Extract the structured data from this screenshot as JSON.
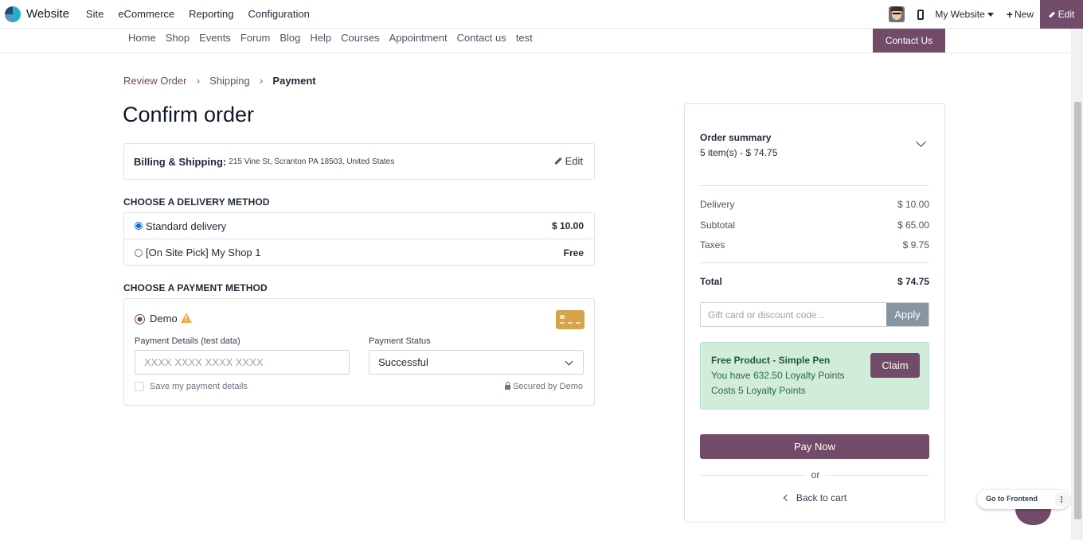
{
  "topbar": {
    "app_name": "Website",
    "menu": [
      "Site",
      "eCommerce",
      "Reporting",
      "Configuration"
    ],
    "site_switcher": "My Website",
    "new_label": "New",
    "edit_label": "Edit"
  },
  "sitenav": {
    "links": [
      "Home",
      "Shop",
      "Events",
      "Forum",
      "Blog",
      "Help",
      "Courses",
      "Appointment",
      "Contact us",
      "test"
    ],
    "contact_button": "Contact Us"
  },
  "breadcrumb": {
    "items": [
      "Review Order",
      "Shipping"
    ],
    "current": "Payment"
  },
  "page_title": "Confirm order",
  "billing": {
    "label": "Billing & Shipping:",
    "address": "215 Vine St, Scranton PA 18503, United States",
    "edit_label": "Edit"
  },
  "delivery": {
    "title": "CHOOSE A DELIVERY METHOD",
    "methods": [
      {
        "name": "Standard delivery",
        "price": "$ 10.00",
        "selected": true
      },
      {
        "name": "[On Site Pick] My Shop 1",
        "price": "Free",
        "selected": false
      }
    ]
  },
  "payment": {
    "title": "CHOOSE A PAYMENT METHOD",
    "provider": "Demo",
    "details_label": "Payment Details (test data)",
    "details_placeholder": "XXXX XXXX XXXX XXXX",
    "status_label": "Payment Status",
    "status_value": "Successful",
    "save_label": "Save my payment details",
    "secured_label": "Secured by Demo"
  },
  "summary": {
    "title": "Order summary",
    "count_line": "5 item(s) -  $ 74.75",
    "rows": [
      {
        "label": "Delivery",
        "value": "$ 10.00"
      },
      {
        "label": "Subtotal",
        "value": "$ 65.00"
      },
      {
        "label": "Taxes",
        "value": "$ 9.75"
      }
    ],
    "total_label": "Total",
    "total_value": "$ 74.75",
    "discount_placeholder": "Gift card or discount code...",
    "apply_label": "Apply",
    "reward": {
      "title": "Free Product - Simple Pen",
      "line1": "You have 632.50 Loyalty Points",
      "line2": "Costs 5 Loyalty Points",
      "claim_label": "Claim"
    },
    "pay_label": "Pay Now",
    "or_label": "or",
    "back_label": "Back to cart"
  },
  "floating": {
    "frontend_label": "Go to Frontend"
  },
  "colors": {
    "brand": "#714b67",
    "reward_bg": "#d1ecdb",
    "apply_bg": "#8595a2"
  }
}
